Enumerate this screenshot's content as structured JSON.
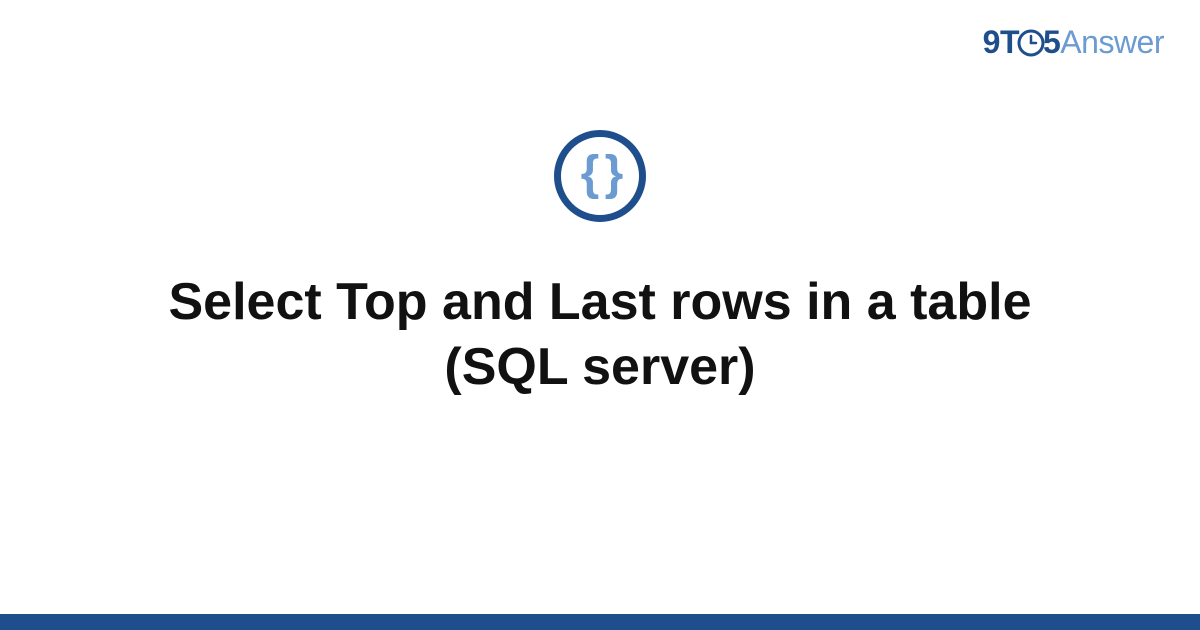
{
  "brand": {
    "part1": "9T",
    "part2": "5",
    "part3": "Answer"
  },
  "icon": {
    "name": "code-braces",
    "glyph": "{ }"
  },
  "title": "Select Top and Last rows in a table (SQL server)",
  "colors": {
    "primary": "#1e4e8c",
    "secondary": "#6b9bd1"
  }
}
